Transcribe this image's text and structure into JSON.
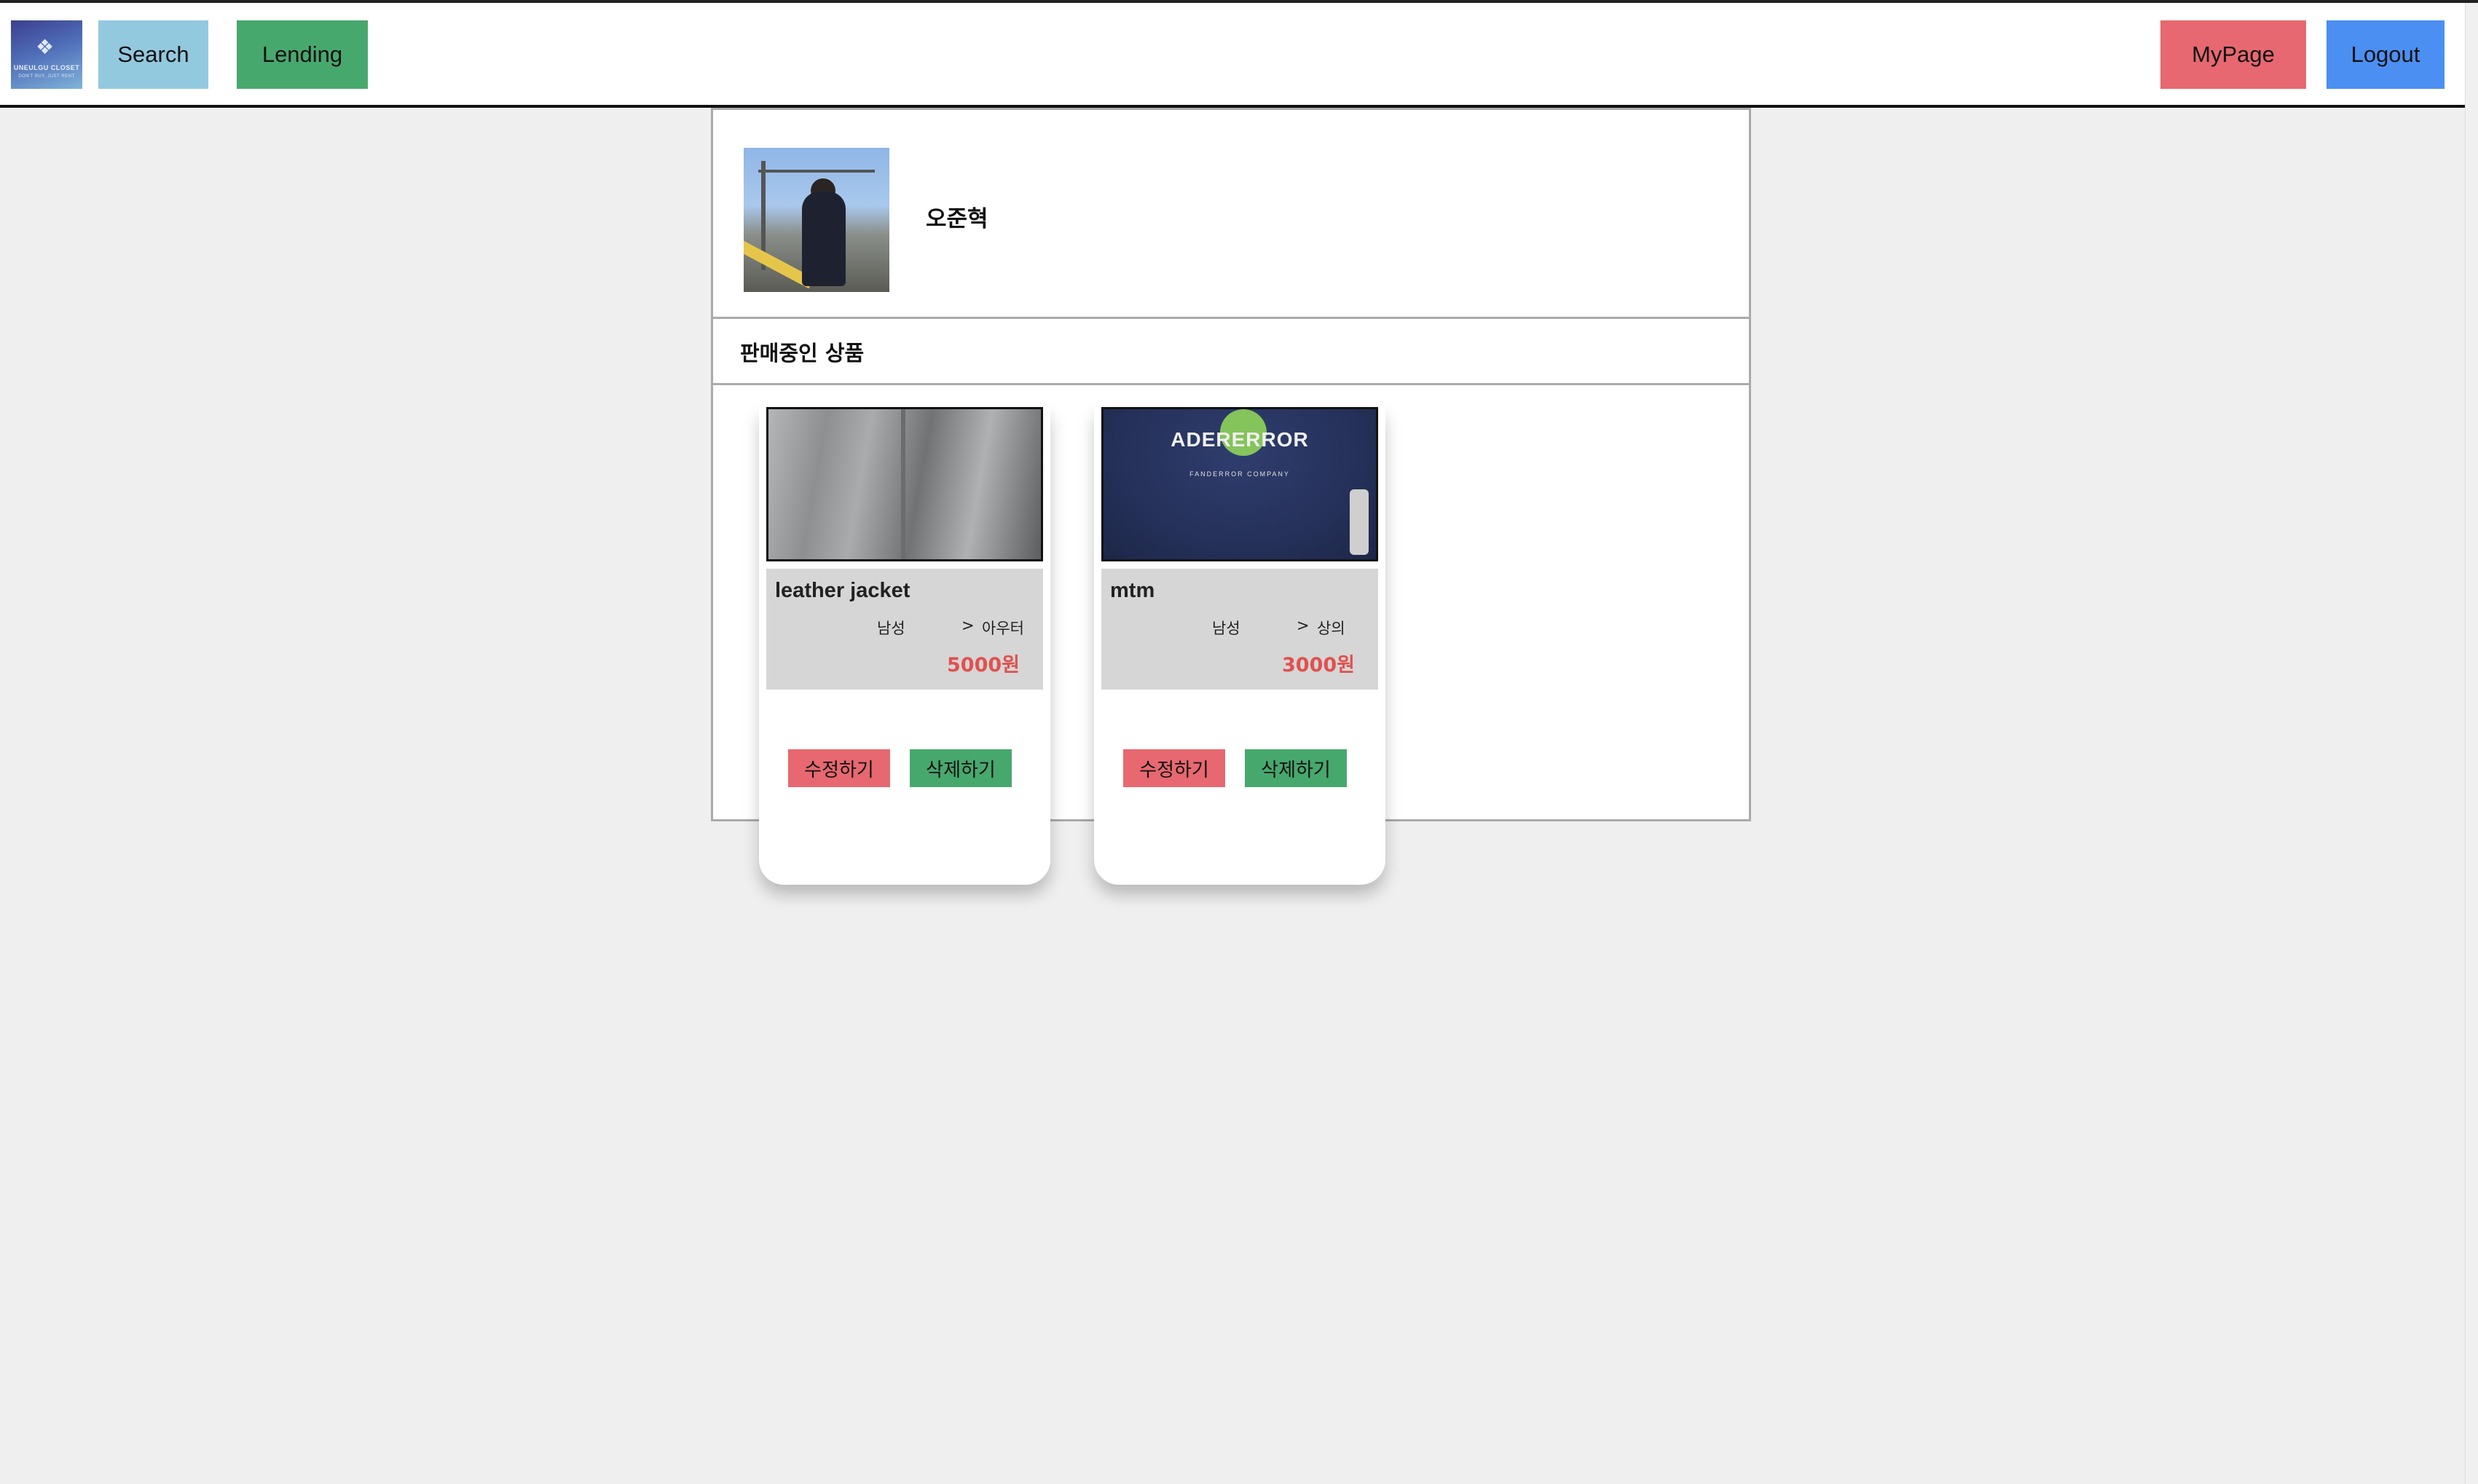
{
  "header": {
    "logo_title": "UNEULGU CLOSET",
    "logo_sub": "DON'T BUY, JUST RENT",
    "nav": {
      "search": "Search",
      "lending": "Lending",
      "mypage": "MyPage",
      "logout": "Logout"
    }
  },
  "profile": {
    "name": "오준혁"
  },
  "section": {
    "title": "판매중인 상품"
  },
  "products": [
    {
      "name": "leather jacket",
      "category1": "남성",
      "separator": ">",
      "category2": "아우터",
      "price": "5000원",
      "edit_label": "수정하기",
      "delete_label": "삭제하기"
    },
    {
      "name": "mtm",
      "category1": "남성",
      "separator": ">",
      "category2": "상의",
      "price": "3000원",
      "edit_label": "수정하기",
      "delete_label": "삭제하기",
      "image_text": "ADERERROR",
      "image_subtext": "FANDERROR COMPANY"
    }
  ],
  "colors": {
    "search": "#93c9df",
    "lending": "#47a86e",
    "mypage": "#e76870",
    "logout": "#4b8ff3",
    "price": "#e0514f"
  }
}
